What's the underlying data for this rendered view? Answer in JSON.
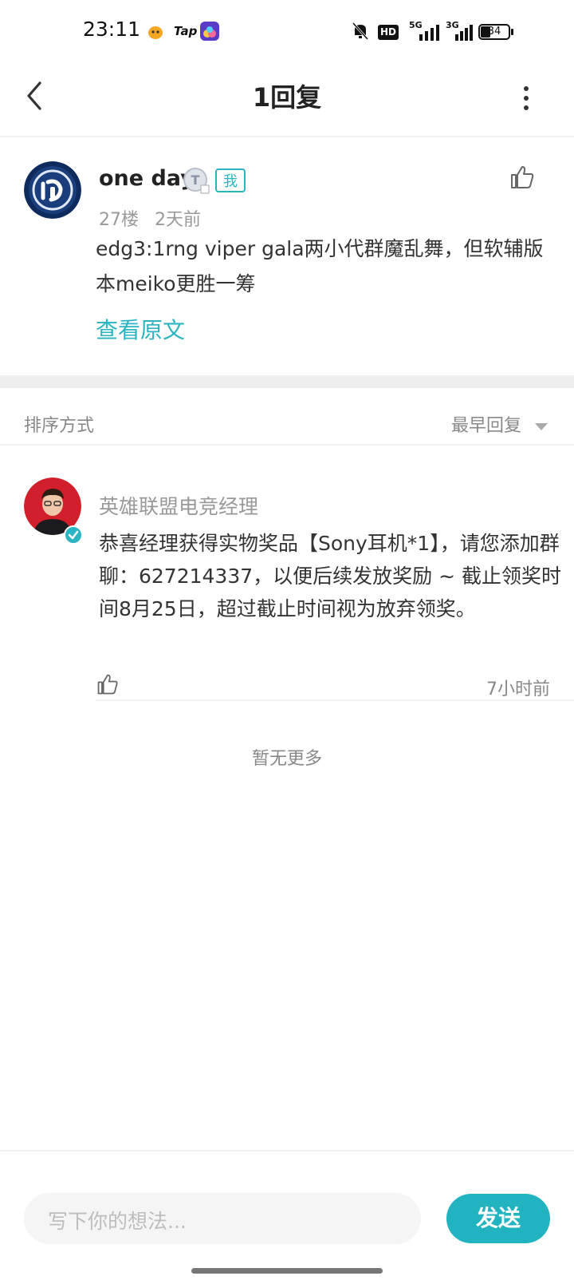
{
  "status_bar": {
    "time": "23:11",
    "tap_label": "Tap",
    "hd_label": "HD",
    "net1_label": "5G",
    "net2_label": "3G",
    "battery": "34",
    "icons": [
      "notification-app-icon",
      "tap-app-icon",
      "game-app-icon",
      "mute-bell-icon",
      "hd-icon",
      "signal-5g-icon",
      "signal-3g-icon",
      "battery-icon"
    ]
  },
  "header": {
    "title": "1回复",
    "back_icon": "chevron-left-icon",
    "more_icon": "more-vertical-icon"
  },
  "post": {
    "author": "one day",
    "medal_letter": "T",
    "me_badge": "我",
    "floor": "27楼",
    "time": "2天前",
    "content": "edg3:1rng viper gala两小代群魔乱舞，但软辅版本meiko更胜一筹",
    "view_original": "查看原文"
  },
  "sort": {
    "label": "排序方式",
    "value": "最早回复"
  },
  "reply": {
    "author": "英雄联盟电竞经理",
    "content": "恭喜经理获得实物奖品【Sony耳机*1】，请您添加群聊：627214337，以便后续发放奖励 ~ 截止领奖时间8月25日，超过截止时间视为放弃领奖。",
    "time": "7小时前"
  },
  "footer": {
    "no_more": "暂无更多",
    "input_placeholder": "写下你的想法...",
    "send_label": "发送"
  },
  "colors": {
    "accent": "#2bb5c2",
    "send_button": "#21b4c0",
    "separator": "#eeeeee"
  }
}
